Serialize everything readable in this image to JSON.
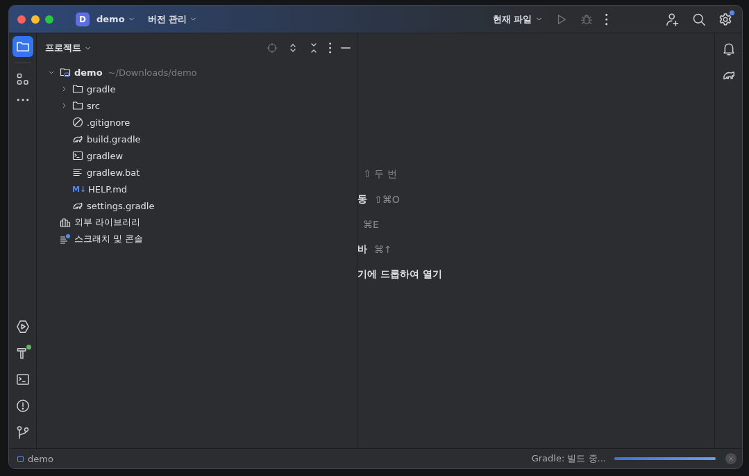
{
  "title_bar": {
    "project_badge": "D",
    "project": "demo",
    "vcs": "버전 관리",
    "run_config": "현재 파일",
    "settings_notification": true
  },
  "left_toolbar": {
    "top": [
      {
        "kind": "folder",
        "selected": true
      },
      {
        "kind": "structure",
        "selected": false
      },
      {
        "kind": "more",
        "selected": false
      }
    ],
    "bottom": [
      {
        "kind": "run",
        "notification": false
      },
      {
        "kind": "build",
        "notification": true
      },
      {
        "kind": "terminal",
        "notification": false
      },
      {
        "kind": "problems",
        "notification": false
      },
      {
        "kind": "git",
        "notification": false
      }
    ]
  },
  "project_panel": {
    "title": "프로젝트",
    "tree": [
      {
        "kind": "module",
        "name": "demo",
        "path": "~/Downloads/demo",
        "expanded": true,
        "children": [
          {
            "kind": "folder",
            "name": "gradle",
            "expanded": false
          },
          {
            "kind": "folder",
            "name": "src",
            "expanded": false
          },
          {
            "kind": "ignore",
            "name": ".gitignore"
          },
          {
            "kind": "gradle",
            "name": "build.gradle"
          },
          {
            "kind": "terminal",
            "name": "gradlew"
          },
          {
            "kind": "text",
            "name": "gradlew.bat"
          },
          {
            "kind": "markdown",
            "badge": "M↓",
            "name": "HELP.md"
          },
          {
            "kind": "gradle",
            "name": "settings.gradle"
          }
        ]
      },
      {
        "kind": "library",
        "name": "외부 라이브러리"
      },
      {
        "kind": "scratch",
        "name": "스크래치 및 콘솔"
      }
    ]
  },
  "editor_hints": [
    {
      "shortcut": "⇧ 두 번"
    },
    {
      "label": "동",
      "shortcut": "⇧⌘O"
    },
    {
      "shortcut": "⌘E"
    },
    {
      "label": "바",
      "shortcut": "⌘↑"
    },
    {
      "label": "기에 드롭하여 열기"
    }
  ],
  "status_bar": {
    "project": "demo",
    "task": "Gradle: 빌드 중...",
    "level": 1
  }
}
